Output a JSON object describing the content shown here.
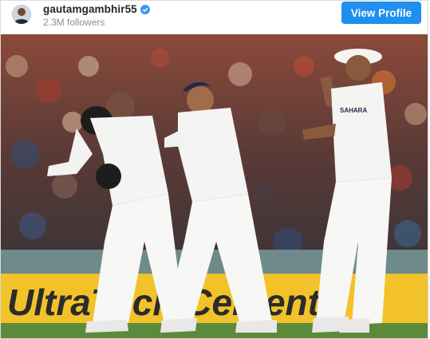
{
  "post": {
    "username": "gautamgambhir55",
    "followers": "2.3M followers",
    "verified": true,
    "view_profile_label": "View Profile"
  },
  "photo": {
    "board_text": "UltraTech Cement",
    "shirt_text": "SAHARA",
    "icons": [
      "avatar-icon",
      "verified-badge-icon"
    ],
    "colors": {
      "button": "#1f8ff0",
      "board": "#f2c22a",
      "pitch": "#5c8a3c"
    }
  }
}
